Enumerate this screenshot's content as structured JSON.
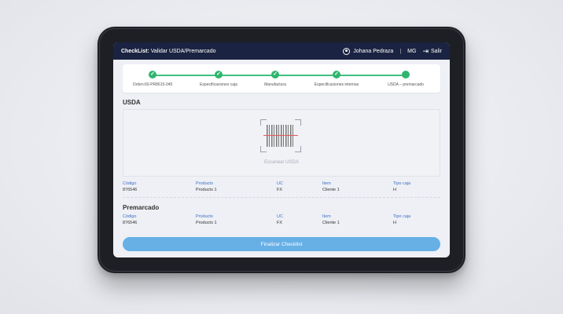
{
  "header": {
    "title_bold": "CheckList:",
    "title_rest": " Validar USDA/Premarcado",
    "user": "Johana Pedraza",
    "user_initials": "MG",
    "logout": "Salir"
  },
  "steps": [
    {
      "label": "Orden:60-PR8615-045",
      "state": "done"
    },
    {
      "label": "Especificaciones caja",
      "state": "done"
    },
    {
      "label": "Manufactura",
      "state": "done"
    },
    {
      "label": "Especificaciones internas",
      "state": "done"
    },
    {
      "label": "USDA – premarcado",
      "state": "current"
    }
  ],
  "usda": {
    "title": "USDA",
    "scan_label": "Escanear USDA",
    "fields": {
      "codigo": {
        "label": "Código",
        "value": "876546"
      },
      "producto": {
        "label": "Producto",
        "value": "Producto 1"
      },
      "uc": {
        "label": "UC",
        "value": "FX"
      },
      "item": {
        "label": "Item",
        "value": "Cliente 1"
      },
      "tipo_caja": {
        "label": "Tipo caja",
        "value": "H"
      }
    }
  },
  "premarcado": {
    "title": "Premarcado",
    "fields": {
      "codigo": {
        "label": "Código",
        "value": "876546"
      },
      "producto": {
        "label": "Producto",
        "value": "Producto 1"
      },
      "uc": {
        "label": "UC",
        "value": "FX"
      },
      "item": {
        "label": "Item",
        "value": "Cliente 1"
      },
      "tipo_caja": {
        "label": "Tipo caja",
        "value": "H"
      }
    }
  },
  "actions": {
    "finish": "Finalizar Checklist"
  },
  "colors": {
    "topbar": "#1a2341",
    "step_done": "#2fb56e",
    "accent": "#3b6fc4",
    "button": "#67b0e6"
  }
}
